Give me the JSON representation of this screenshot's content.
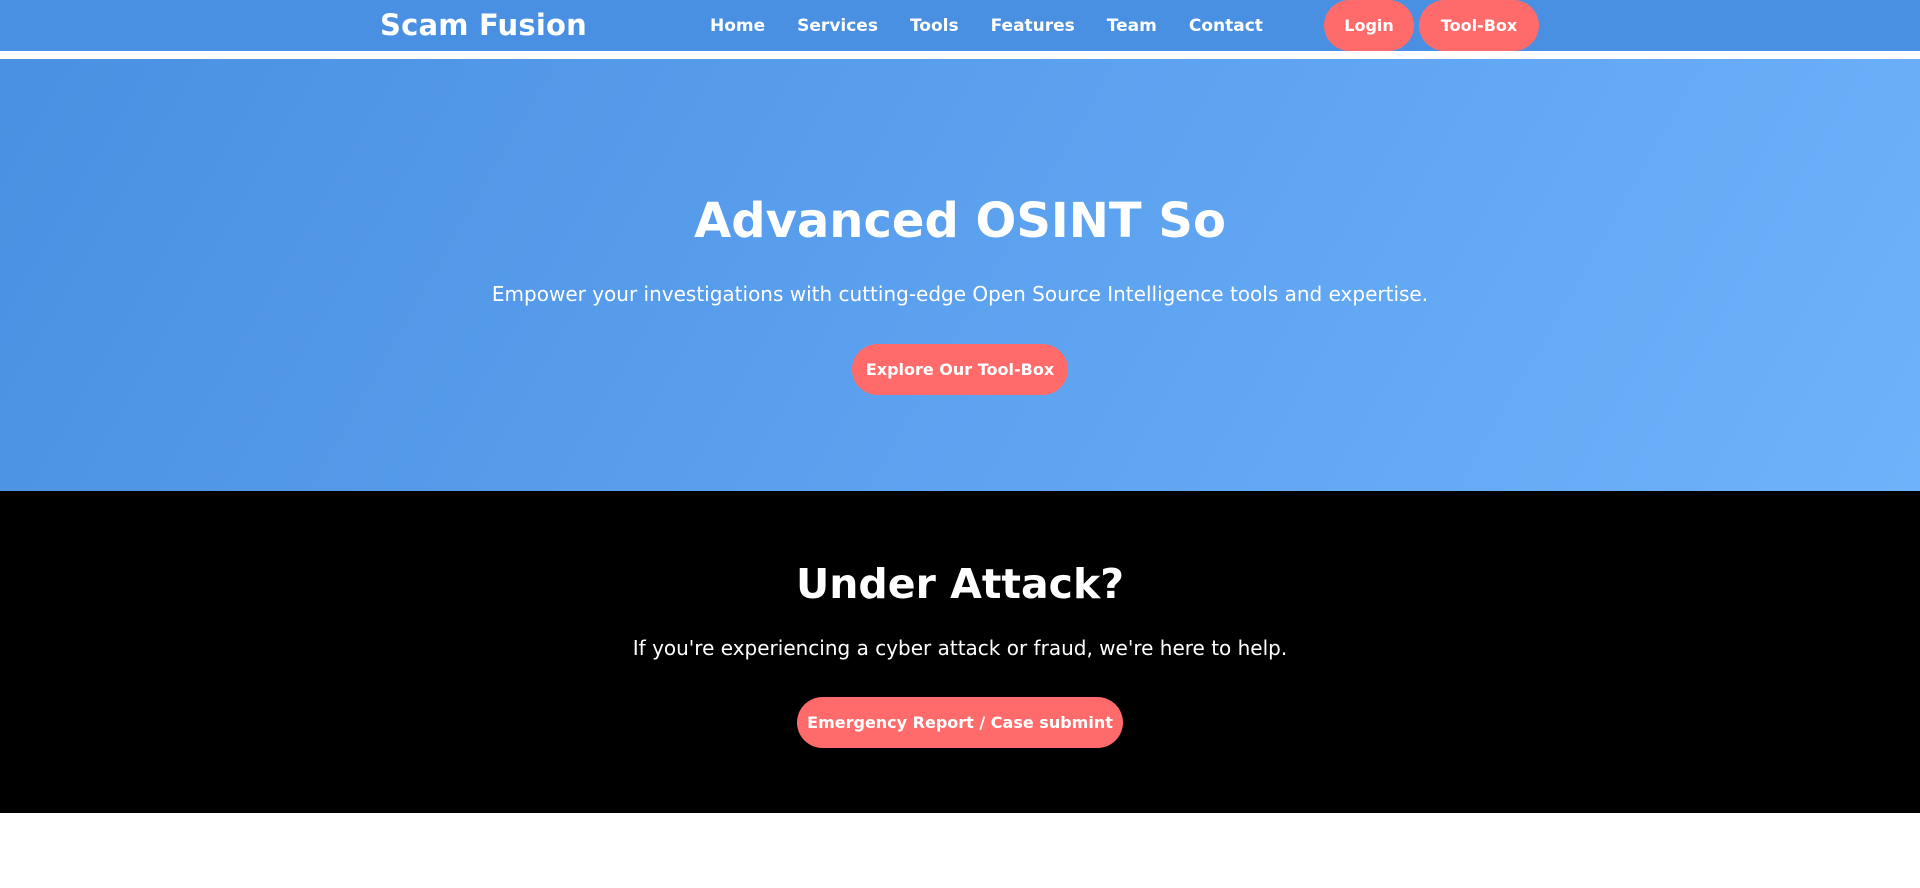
{
  "header": {
    "brand": "Scam Fusion",
    "nav": [
      "Home",
      "Services",
      "Tools",
      "Features",
      "Team",
      "Contact"
    ],
    "buttons": {
      "login": "Login",
      "toolbox": "Tool-Box"
    }
  },
  "hero": {
    "title": "Advanced OSINT So",
    "subtitle": "Empower your investigations with cutting-edge Open Source Intelligence tools and expertise.",
    "cta": "Explore Our Tool-Box"
  },
  "attack": {
    "title": "Under Attack?",
    "text": "If you're experiencing a cyber attack or fraud, we're here to help.",
    "cta": "Emergency Report / Case submint"
  },
  "colors": {
    "nav_bg": "#4a90e2",
    "hero_gradient_start": "#4a90e2",
    "hero_gradient_end": "#6eb2fb",
    "accent": "#ff6b6b",
    "attack_bg": "#000000"
  }
}
